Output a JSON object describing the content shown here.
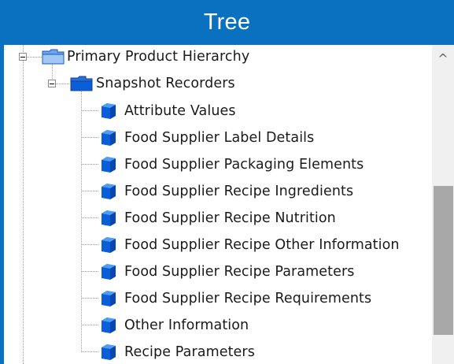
{
  "panel": {
    "title": "Tree"
  },
  "tree": {
    "root": {
      "label": "Primary Product Hierarchy",
      "icon": "folder-icon",
      "expanded": true
    },
    "group": {
      "label": "Snapshot Recorders",
      "icon": "folder-icon",
      "expanded": true
    },
    "items": [
      {
        "label": "Attribute Values",
        "icon": "cube-icon"
      },
      {
        "label": "Food Supplier Label Details",
        "icon": "cube-icon"
      },
      {
        "label": "Food Supplier Packaging Elements",
        "icon": "cube-icon"
      },
      {
        "label": "Food Supplier Recipe Ingredients",
        "icon": "cube-icon"
      },
      {
        "label": "Food Supplier Recipe Nutrition",
        "icon": "cube-icon"
      },
      {
        "label": "Food Supplier Recipe Other Information",
        "icon": "cube-icon"
      },
      {
        "label": "Food Supplier Recipe Parameters",
        "icon": "cube-icon"
      },
      {
        "label": "Food Supplier Recipe Requirements",
        "icon": "cube-icon"
      },
      {
        "label": "Other Information",
        "icon": "cube-icon"
      },
      {
        "label": "Recipe Parameters",
        "icon": "cube-icon"
      }
    ]
  },
  "scrollbar": {
    "up_arrow": "^",
    "position_fraction": 0.55
  },
  "colors": {
    "header_bg": "#0a70c0",
    "header_text": "#ffffff",
    "cube_blue": "#0a5ed8",
    "folder_blue": "#3b7be0"
  }
}
